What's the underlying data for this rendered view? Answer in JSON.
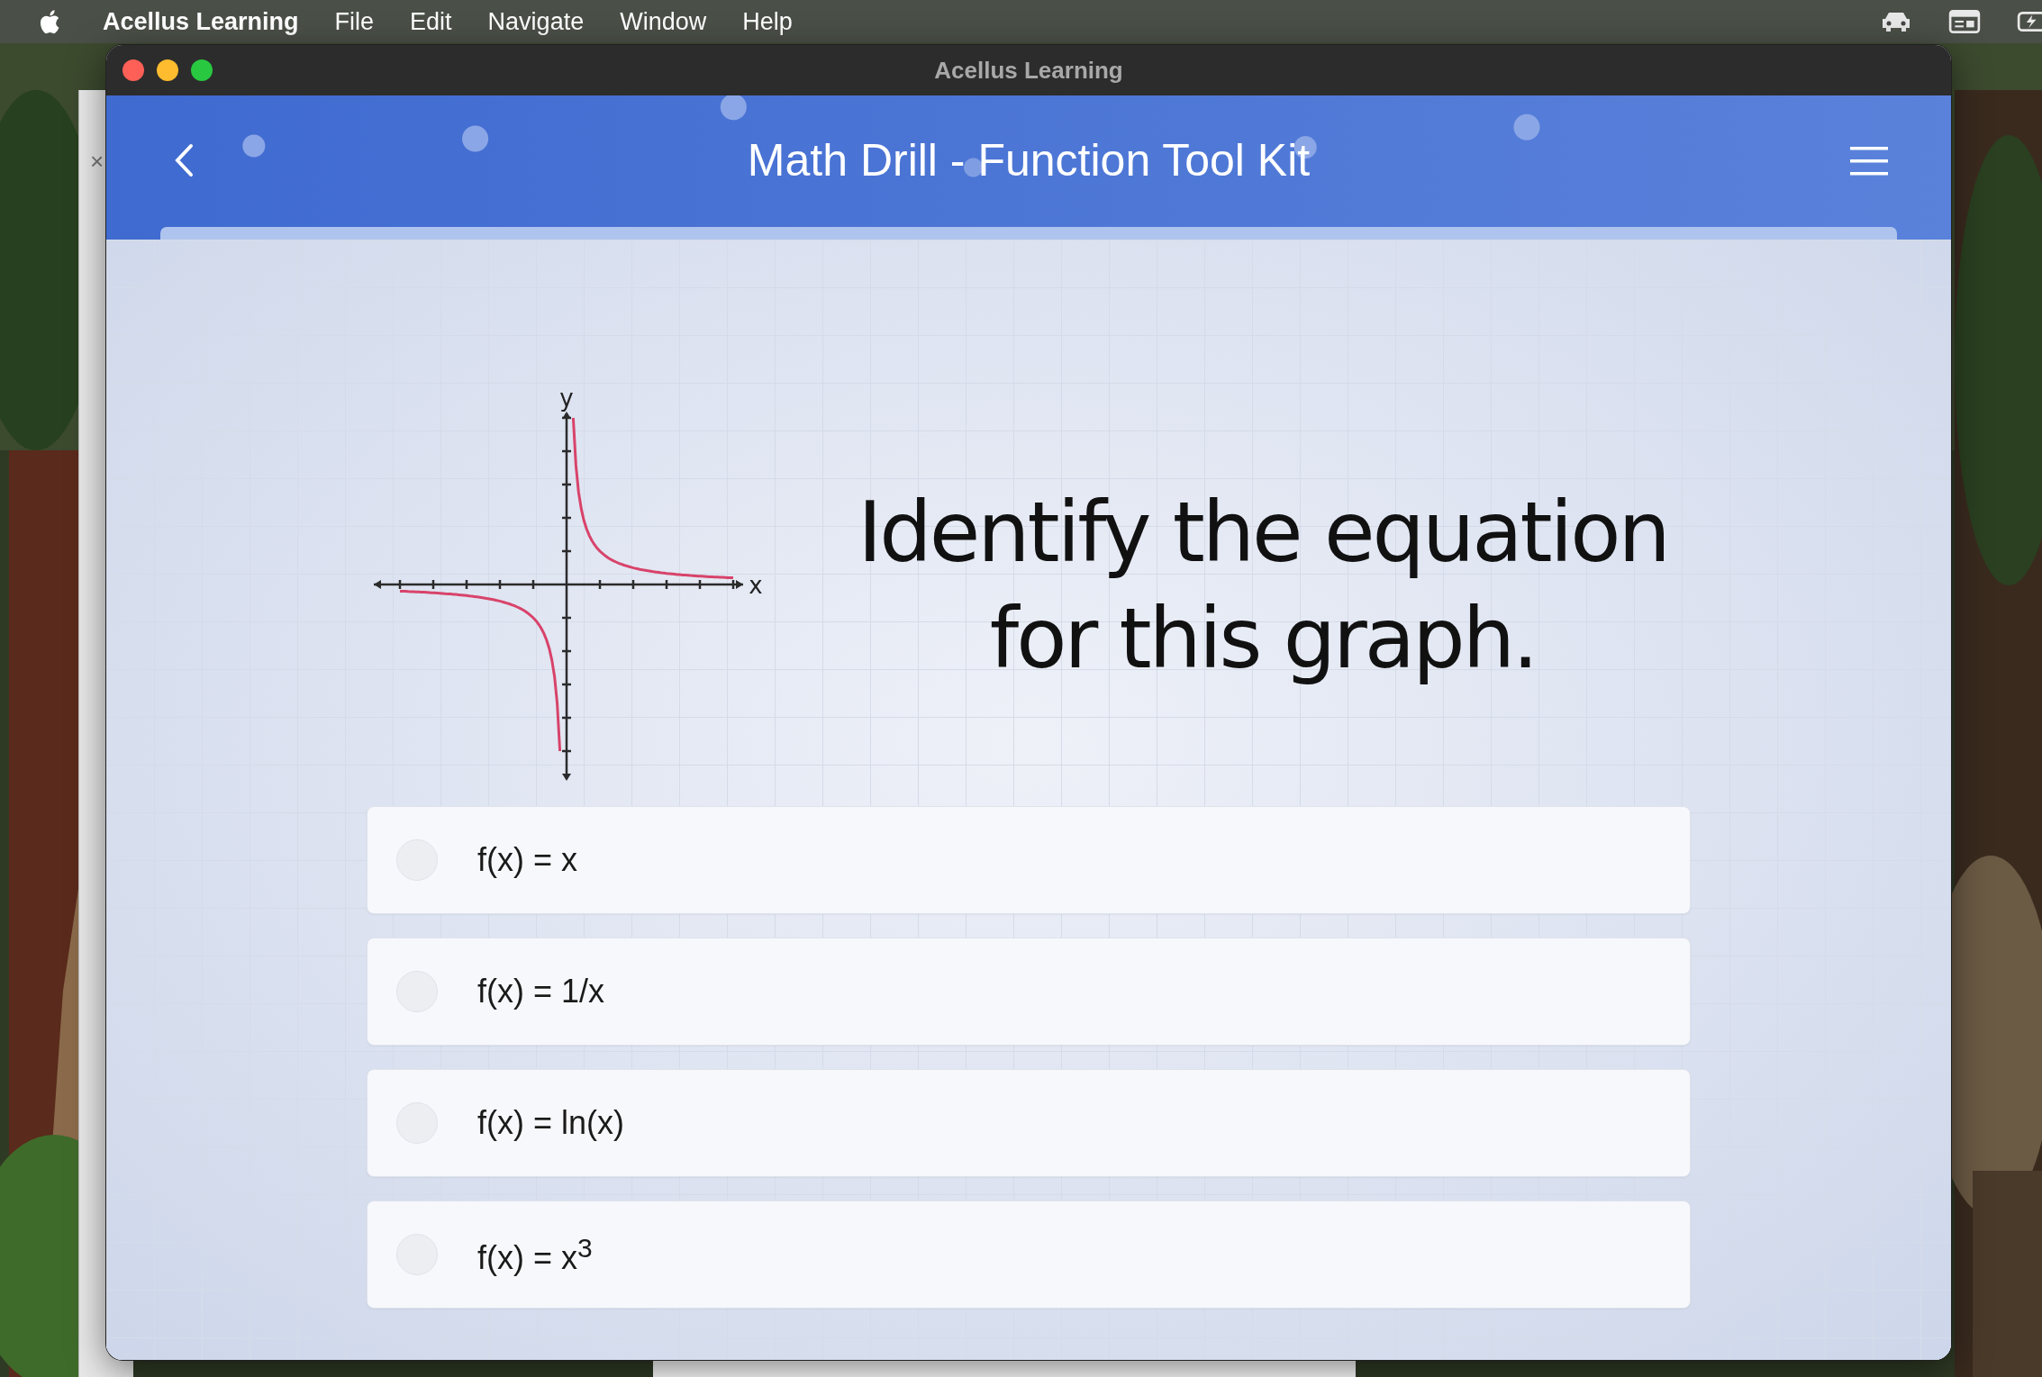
{
  "menu_bar": {
    "app_name": "Acellus Learning",
    "menus": [
      "File",
      "Edit",
      "Navigate",
      "Window",
      "Help"
    ]
  },
  "background_window": {
    "close_glyph": "×"
  },
  "window": {
    "title": "Acellus Learning"
  },
  "header": {
    "title": "Math Drill - Function Tool Kit"
  },
  "graph": {
    "y_label": "y",
    "x_label": "x"
  },
  "question": "Identify the equation for this graph.",
  "options": [
    {
      "text": "f(x) = x",
      "selected": false
    },
    {
      "text": "f(x) = 1/x",
      "selected": false
    },
    {
      "text": "f(x) = ln(x)",
      "selected": false
    },
    {
      "text": "f(x) = x$^{3}$",
      "selected": false
    }
  ]
}
